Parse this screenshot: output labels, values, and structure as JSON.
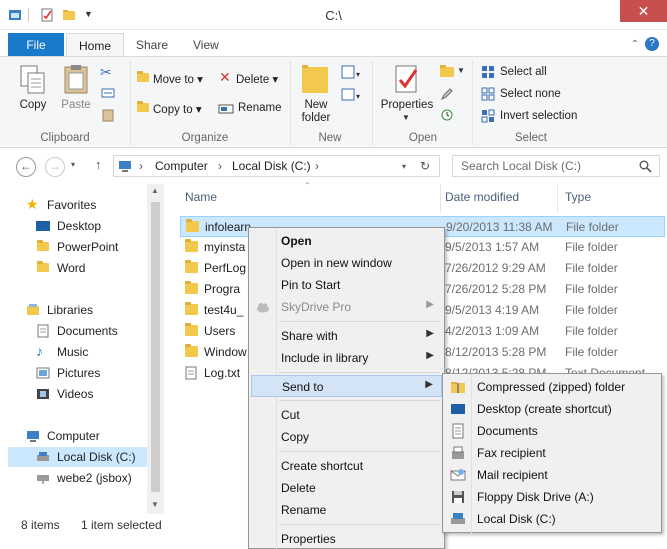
{
  "window": {
    "title": "C:\\",
    "close_glyph": "✕"
  },
  "ribbon_tabs": [
    "File",
    "Home",
    "Share",
    "View"
  ],
  "ribbon": {
    "clipboard": {
      "copy": "Copy",
      "paste": "Paste",
      "group": "Clipboard"
    },
    "organize": {
      "move_to": "Move to ▾",
      "copy_to": "Copy to ▾",
      "delete": "Delete ▾",
      "rename": "Rename",
      "group": "Organize"
    },
    "new": {
      "new_folder_line1": "New",
      "new_folder_line2": "folder",
      "group": "New"
    },
    "open": {
      "properties": "Properties",
      "group": "Open"
    },
    "select": {
      "select_all": "Select all",
      "select_none": "Select none",
      "invert_selection": "Invert selection",
      "group": "Select"
    }
  },
  "address": {
    "crumbs": [
      "Computer",
      "Local Disk (C:)"
    ],
    "search_placeholder": "Search Local Disk (C:)"
  },
  "nav": {
    "favorites_header": "Favorites",
    "favorites": [
      "Desktop",
      "PowerPoint",
      "Word"
    ],
    "libraries_header": "Libraries",
    "libraries": [
      "Documents",
      "Music",
      "Pictures",
      "Videos"
    ],
    "computer_header": "Computer",
    "computer": [
      "Local Disk (C:)",
      "webe2 (jsbox)"
    ]
  },
  "columns": {
    "name": "Name",
    "date": "Date modified",
    "type": "Type"
  },
  "files": [
    {
      "name": "infolearn",
      "date": "9/20/2013 11:38 AM",
      "type": "File folder"
    },
    {
      "name": "myinsta",
      "date": "9/5/2013 1:57 AM",
      "type": "File folder"
    },
    {
      "name": "PerfLog",
      "date": "7/26/2012 9:29 AM",
      "type": "File folder"
    },
    {
      "name": "Progra",
      "date": "7/26/2012 5:28 PM",
      "type": "File folder"
    },
    {
      "name": "test4u_",
      "date": "9/5/2013 4:19 AM",
      "type": "File folder"
    },
    {
      "name": "Users",
      "date": "4/2/2013 1:09 AM",
      "type": "File folder"
    },
    {
      "name": "Window",
      "date": "8/12/2013 5:28 PM",
      "type": "File folder"
    },
    {
      "name": "Log.txt",
      "date": "8/12/2013 5:28 PM",
      "type": "Text Document"
    }
  ],
  "status": {
    "count": "8 items",
    "selected": "1 item selected"
  },
  "context_menu": {
    "open": "Open",
    "open_new_window": "Open in new window",
    "pin_to_start": "Pin to Start",
    "skydrive_pro": "SkyDrive Pro",
    "share_with": "Share with",
    "include_in_library": "Include in library",
    "send_to": "Send to",
    "cut": "Cut",
    "copy": "Copy",
    "create_shortcut": "Create shortcut",
    "delete": "Delete",
    "rename": "Rename",
    "properties": "Properties",
    "arrow": "▶"
  },
  "send_to_menu": [
    "Compressed (zipped) folder",
    "Desktop (create shortcut)",
    "Documents",
    "Fax recipient",
    "Mail recipient",
    "Floppy Disk Drive (A:)",
    "Local Disk (C:)"
  ],
  "colors": {
    "accent": "#1979ca",
    "selection": "#cce8ff",
    "close": "#c7504f",
    "menu_bg": "#f0f0f0"
  }
}
